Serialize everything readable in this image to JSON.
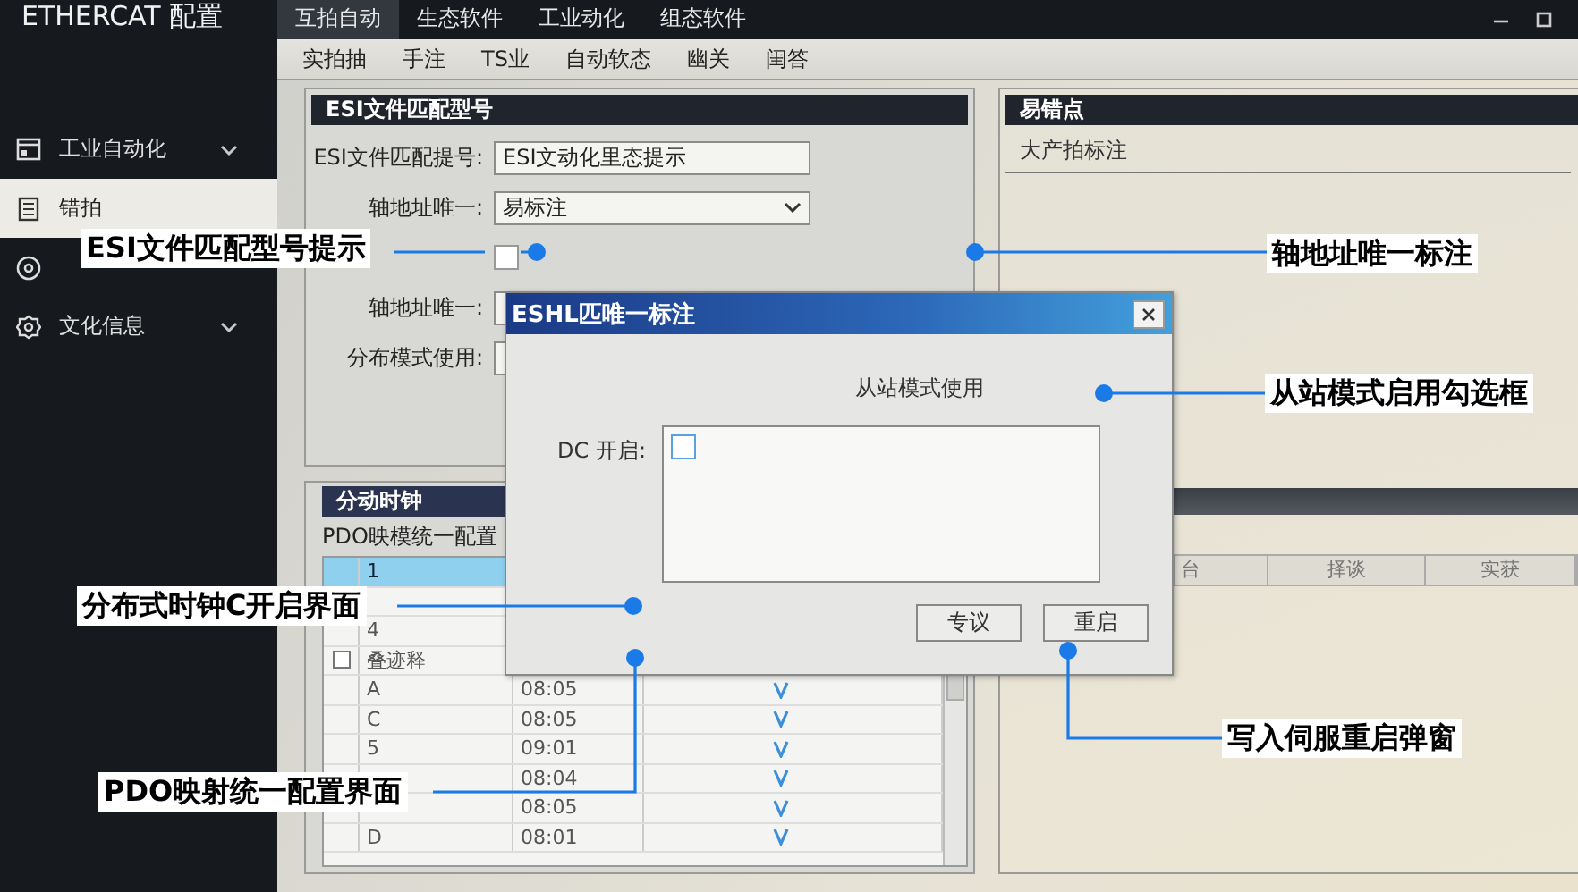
{
  "app_title": "ETHERCAT 配置",
  "menu_tabs": [
    {
      "label": "互拍自动",
      "selected": true
    },
    {
      "label": "生态软件",
      "selected": false
    },
    {
      "label": "工业动化",
      "selected": false
    },
    {
      "label": "组态软件",
      "selected": false
    }
  ],
  "toolbar": [
    "实拍抽",
    "手注",
    "TS业",
    "自动软态",
    "幽关",
    "闺答"
  ],
  "sidebar": {
    "items": [
      {
        "label": "工业自动化",
        "expandable": true,
        "selected": false
      },
      {
        "label": "错拍",
        "expandable": false,
        "selected": true
      },
      {
        "expandable": false,
        "selected": false
      },
      {
        "label": "文化信息",
        "expandable": true,
        "selected": false
      }
    ]
  },
  "esi_panel": {
    "title": "ESI文件匹配型号",
    "fields": [
      {
        "kind": "text",
        "label": "ESI文件匹配提号:",
        "value": "ESI文动化里态提示"
      },
      {
        "kind": "select",
        "label": "轴地址唯一:",
        "value": "易标注"
      },
      {
        "kind": "checkbox",
        "checked": false
      },
      {
        "kind": "text",
        "label": "轴地址唯一:"
      },
      {
        "kind": "text",
        "label": "分布模式使用:"
      }
    ]
  },
  "clock_panel": {
    "title": "分动时钟",
    "caption": "PDO映模统一配置",
    "rows": [
      {
        "name": "1",
        "selected": true
      },
      {
        "selected": false
      },
      {
        "name": "4",
        "selected": false
      },
      {
        "name": "叠迹释",
        "kind": "checkbox",
        "checked": false,
        "selected": false
      },
      {
        "name": "A",
        "time": "08:05",
        "checked": true,
        "selected": false
      },
      {
        "name": "C",
        "time": "08:05",
        "checked": true,
        "selected": false
      },
      {
        "name": "5",
        "time": "09:01",
        "checked": true,
        "selected": false
      },
      {
        "time": "08:04",
        "checked": true,
        "selected": false
      },
      {
        "time": "08:05",
        "checked": true,
        "selected": false
      },
      {
        "name": "D",
        "time": "08:01",
        "checked": true,
        "selected": false
      }
    ]
  },
  "error_panel": {
    "title": "易错点",
    "subtitle": "大产拍标注",
    "columns": [
      "台",
      "择谈",
      "实获"
    ]
  },
  "dialog": {
    "title": "ESHL匹唯一标注",
    "heading": "从站模式使用",
    "dc_label": "DC 开启:",
    "dc_checked": false,
    "buttons": [
      "专议",
      "重启"
    ]
  },
  "callouts": [
    {
      "text": "ESI文件匹配型号提示"
    },
    {
      "text": "轴地址唯一标注"
    },
    {
      "text": "从站模式启用勾选框"
    },
    {
      "text": "分布式时钟C开启界面"
    },
    {
      "text": "PDO映射统一配置界面"
    },
    {
      "text": "写入伺服重启弹窗"
    }
  ]
}
